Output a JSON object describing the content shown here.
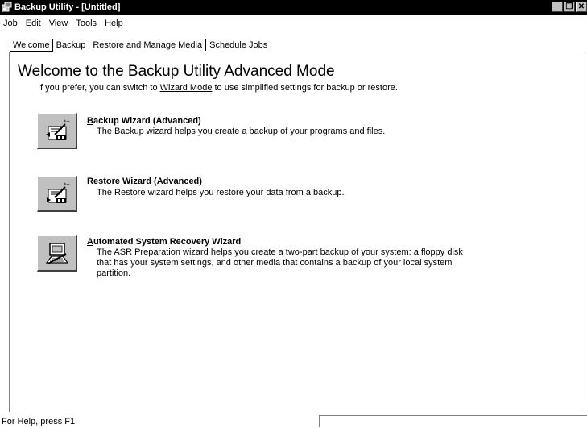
{
  "window": {
    "title": "Backup Utility - [Untitled]",
    "minimize_glyph": "_",
    "restore_glyph": "❐",
    "close_glyph": "✕"
  },
  "menu": [
    {
      "accel": "J",
      "rest": "ob"
    },
    {
      "accel": "E",
      "rest": "dit"
    },
    {
      "accel": "V",
      "rest": "iew"
    },
    {
      "accel": "T",
      "rest": "ools"
    },
    {
      "accel": "H",
      "rest": "elp"
    }
  ],
  "tabs": [
    "Welcome",
    "Backup",
    "Restore and Manage Media",
    "Schedule Jobs"
  ],
  "main": {
    "heading": "Welcome to the Backup Utility Advanced Mode",
    "intro_before": "If you prefer, you can switch to ",
    "intro_link": "Wizard Mode",
    "intro_after": " to use simplified settings for backup or restore."
  },
  "wizards": [
    {
      "accel": "B",
      "title_rest": "ackup Wizard (Advanced)",
      "desc": "The Backup wizard helps you create a backup of your programs and files.",
      "icon": "backup-wizard-icon"
    },
    {
      "accel": "R",
      "title_rest": "estore Wizard (Advanced)",
      "desc": "The Restore wizard helps you restore your data from a backup.",
      "icon": "restore-wizard-icon"
    },
    {
      "accel": "A",
      "title_rest": "utomated System Recovery Wizard",
      "desc": "The ASR Preparation wizard helps you create a two-part backup of your system: a floppy disk that has your system settings, and other media that contains a backup of your local system partition.",
      "icon": "asr-wizard-icon"
    }
  ],
  "status": {
    "text": "For Help, press F1"
  }
}
